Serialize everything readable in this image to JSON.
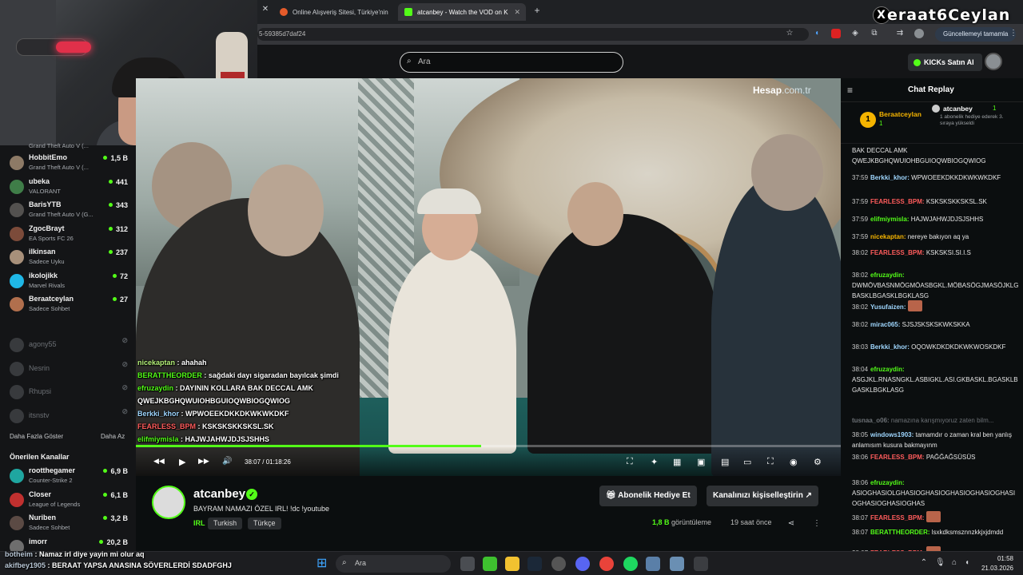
{
  "browser": {
    "tabs": [
      {
        "label": "Online Alışveriş Sitesi, Türkiye'nin",
        "fav": "#e55b2a"
      },
      {
        "label": "atcanbey - Watch the VOD on K",
        "fav": "#53fc18"
      }
    ],
    "url": "5-59385d7daf24",
    "update_label": "Güncellemeyi tamamla"
  },
  "watermark": {
    "logo": "X",
    "text": "eraat6Ceylan"
  },
  "topbar": {
    "search_placeholder": "Ara",
    "kicks_label": "KICKs Satın Al"
  },
  "sidebar": {
    "top_game": "Grand Theft Auto V (...",
    "channels": [
      {
        "name": "HobbitEmo",
        "game": "Grand Theft Auto V (...",
        "viewers": "1,5 B",
        "color": "#8d7a66"
      },
      {
        "name": "ubeka",
        "game": "VALORANT",
        "viewers": "441",
        "color": "#3f7d48"
      },
      {
        "name": "BarisYTB",
        "game": "Grand Theft Auto V (G...",
        "viewers": "343",
        "color": "#53514f"
      },
      {
        "name": "ZgocBrayt",
        "game": "EA Sports FC 26",
        "viewers": "312",
        "color": "#7c4b3a"
      },
      {
        "name": "ilkinsan",
        "game": "Sadece Uyku",
        "viewers": "237",
        "color": "#a8907a"
      },
      {
        "name": "ikolojikk",
        "game": "Marvel Rivals",
        "viewers": "72",
        "color": "#1fb7e6"
      },
      {
        "name": "Beraatceylan",
        "game": "Sadece Sohbet",
        "viewers": "27",
        "color": "#b16f4d"
      }
    ],
    "offline": [
      {
        "name": "agony55",
        "badge": "⊘"
      },
      {
        "name": "Nesrin",
        "badge": "⊘"
      },
      {
        "name": "Rhupsi",
        "badge": "⊘"
      },
      {
        "name": "itsnstv",
        "badge": "⊘"
      }
    ],
    "show_more": "Daha Fazla Göster",
    "show_less": "Daha Az",
    "recommended_title": "Önerilen Kanallar",
    "recommended": [
      {
        "name": "rootthegamer",
        "game": "Counter-Strike 2",
        "viewers": "6,9 B",
        "color": "#1fa6a0"
      },
      {
        "name": "Closer",
        "game": "League of Legends",
        "viewers": "6,1 B",
        "color": "#c0302f"
      },
      {
        "name": "Nuriben",
        "game": "Sadece Sohbet",
        "viewers": "3,2 B",
        "color": "#5b4a44"
      },
      {
        "name": "imorr",
        "game": "",
        "viewers": "20,2 B",
        "color": "#6e6e6e"
      }
    ]
  },
  "video": {
    "brand": "Hesap",
    "brand_suffix": ".com.tr",
    "overlay_chat": [
      {
        "user": "nicekaptan",
        "text": " : ahahah",
        "cls": "u1"
      },
      {
        "user": "BERATTHEORDER",
        "text": " : sağdaki dayı sigaradan bayılcak şimdi",
        "cls": "u2"
      },
      {
        "user": "efruzaydin",
        "text": " : DAYININ KOLLARA BAK DECCAL AMK QWEJKBGHQWUIOHBGUIOQWBIOGQWIOG",
        "cls": "u2"
      },
      {
        "user": "Berkki_khor",
        "text": " : WPWOEEKDKKDKWKWKDKF",
        "cls": "u3"
      },
      {
        "user": "FEARLESS_BPM",
        "text": " : KSKSKSKKSKSL.SK",
        "cls": "u4"
      },
      {
        "user": "elifmiymisla",
        "text": " : HAJWJAHWJDJSJSHHS",
        "cls": "u2"
      }
    ],
    "time": "38:07 / 01:18:26",
    "progress": 0.49
  },
  "stream": {
    "streamer": "atcanbey",
    "title": "BAYRAM NAMAZI ÖZEL IRL! !dc !youtube",
    "category": "IRL",
    "tags": [
      "Turkish",
      "Türkçe"
    ],
    "gift_label": "Abonelik Hediye Et",
    "customize_label": "Kanalınızı kişiselleştirin",
    "views_count": "1,8 B",
    "views_suffix": "görüntüleme",
    "ago": "19 saat önce"
  },
  "chat": {
    "title": "Chat Replay",
    "pinned_user": "Beraatceylan",
    "pinned_gift_count": "1",
    "pinned_sub_count": "1",
    "pinned_gifter": "atcanbey",
    "pinned_gifter_count": "1",
    "pinned_text": "1 abonelik hediye ederek 3. sıraya yükseldi",
    "messages": [
      {
        "ts": "",
        "user": "",
        "text": "BAK DECCAL AMK QWEJKBGHQWUIOHBGUIOQWBIOGQWIOG",
        "color": "#e6e6e6"
      },
      {
        "ts": "37:59",
        "user": "Berkki_khor:",
        "text": "WPWOEEKDKKDKWKWKDKF",
        "color": "#9fd7ff"
      },
      {
        "ts": "37:59",
        "user": "FEARLESS_BPM:",
        "text": "KSKSKSKKSKSL.SK",
        "color": "#ff5c5c"
      },
      {
        "ts": "37:59",
        "user": "elifmiymisla:",
        "text": "HAJWJAHWJDJSJSHHS",
        "color": "#53fc18"
      },
      {
        "ts": "37:59",
        "user": "nicekaptan:",
        "text": "nereye bakıyon aq ya",
        "color": "#f5b400"
      },
      {
        "ts": "38:02",
        "user": "FEARLESS_BPM:",
        "text": "KSKSKSI.SI.I.S",
        "color": "#ff5c5c"
      },
      {
        "ts": "38:02",
        "user": "efruzaydin:",
        "text": "DWMÖVBASNMÖGMÖASBGKL.MÖBASÖGJMASÖJKLGBASKLBGASKLBGKLASG",
        "color": "#53fc18"
      },
      {
        "ts": "38:02",
        "user": "Yusufaizen:",
        "text": "",
        "color": "#9fd7ff"
      },
      {
        "ts": "38:02",
        "user": "mirac065:",
        "text": "SJSJSKSKSKWKSKKA",
        "color": "#9fd7ff"
      },
      {
        "ts": "38:03",
        "user": "Berkki_khor:",
        "text": "OQOWKDKDKDKWKWOSKDKF",
        "color": "#9fd7ff"
      },
      {
        "ts": "38:04",
        "user": "efruzaydin:",
        "text": "ASGJKL.RNASNGKL.ASBIGKL.ASI.GKBASKL.BGASKLBGASKLBGKLASG",
        "color": "#53fc18"
      },
      {
        "ts": "",
        "user": "tusnaa_o06:",
        "text": "namazına karışmıyoruz zaten bilm...",
        "color": "#6d7176"
      },
      {
        "ts": "38:05",
        "user": "windows1903:",
        "text": "tamamdır o zaman kral ben yanlış anlamısım kusura bakmayınm",
        "color": "#9fd7ff"
      },
      {
        "ts": "38:06",
        "user": "FEARLESS_BPM:",
        "text": "PAĞĞAĞSÜSÜS",
        "color": "#ff5c5c"
      },
      {
        "ts": "38:06",
        "user": "efruzaydin:",
        "text": "ASIOGHASIOLGHASIOGHASIOGHASIOGHASIOGHASIOGHASIOGHASIOGHAS",
        "color": "#53fc18"
      },
      {
        "ts": "38:07",
        "user": "FEARLESS_BPM:",
        "text": "",
        "color": "#ff5c5c"
      },
      {
        "ts": "38:07",
        "user": "BERATTHEORDER:",
        "text": "lsxkdksmsznnzkkjxjdmdd",
        "color": "#53fc18"
      },
      {
        "ts": "38:07",
        "user": "FEARLESS_BPM:",
        "text": "",
        "color": "#ff5c5c"
      }
    ]
  },
  "taskbar": {
    "search_placeholder": "Ara",
    "time": "01:58",
    "date": "21.03.2026",
    "overlay_lines": [
      {
        "user": "botheim",
        "text": " : Namaz irl diye yayin mi olur aq"
      },
      {
        "user": "akifbey1905",
        "text": " : BERAAT YAPSA ANASINA SÖVERLERDİ SDADFGHJ"
      }
    ]
  },
  "icons": {
    "play": "▶",
    "prev": "◀◀",
    "next": "▶▶",
    "volume": "🔊",
    "search": "⌕",
    "star": "☆",
    "menu": "≡",
    "share": "⋖",
    "more": "⋮"
  }
}
